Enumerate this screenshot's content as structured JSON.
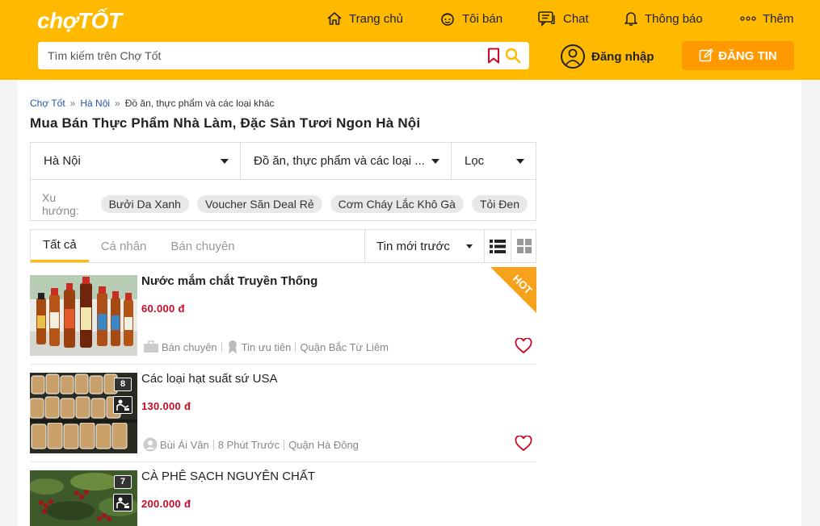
{
  "header": {
    "logo": "chợTỐT",
    "nav": [
      {
        "label": "Trang chủ",
        "icon": "home-icon"
      },
      {
        "label": "Tôi bán",
        "icon": "seller-face-icon"
      },
      {
        "label": "Chat",
        "icon": "chat-icon"
      },
      {
        "label": "Thông báo",
        "icon": "bell-icon"
      },
      {
        "label": "Thêm",
        "icon": "more-dots-icon"
      }
    ],
    "search_placeholder": "Tìm kiếm trên Chợ Tốt",
    "login_label": "Đăng nhập",
    "post_label": "ĐĂNG TIN",
    "colors": {
      "brand": "#ffba00",
      "accent": "#fe9900",
      "price": "#c90927"
    }
  },
  "breadcrumb": [
    "Chợ Tốt",
    "Hà Nội",
    "Đồ ăn, thực phẩm và các loại khác"
  ],
  "page_title": "Mua Bán Thực Phẩm Nhà Làm, Đặc Sản Tươi Ngon Hà Nội",
  "filters": {
    "location": "Hà Nội",
    "category": "Đồ ăn, thực phẩm và các loại ...",
    "filter": "Lọc",
    "trend_label": "Xu hướng:",
    "trends": [
      "Bưởi Da Xanh",
      "Voucher Săn Deal Rẻ",
      "Cơm Cháy Lắc Khô Gà",
      "Tỏi Đen"
    ]
  },
  "tabs": [
    "Tất cả",
    "Cá nhân",
    "Bán chuyên"
  ],
  "sort_label": "Tin mới trước",
  "listings": [
    {
      "title": "Nước mắm chắt Truyền Thống",
      "price": "60.000 đ",
      "badge": "HOT",
      "meta": [
        "Bán chuyên",
        "Tin ưu tiên",
        "Quận Bắc Từ Liêm"
      ]
    },
    {
      "title": "Các loại hạt suất sứ USA",
      "price": "130.000 đ",
      "image_count": "8",
      "meta": [
        "Bùi Ái Vân",
        "8 Phút Trước",
        "Quận Hà Đông"
      ]
    },
    {
      "title": "CÀ PHÊ SẠCH NGUYÊN CHẤT",
      "price": "200.000 đ",
      "image_count": "7"
    }
  ]
}
